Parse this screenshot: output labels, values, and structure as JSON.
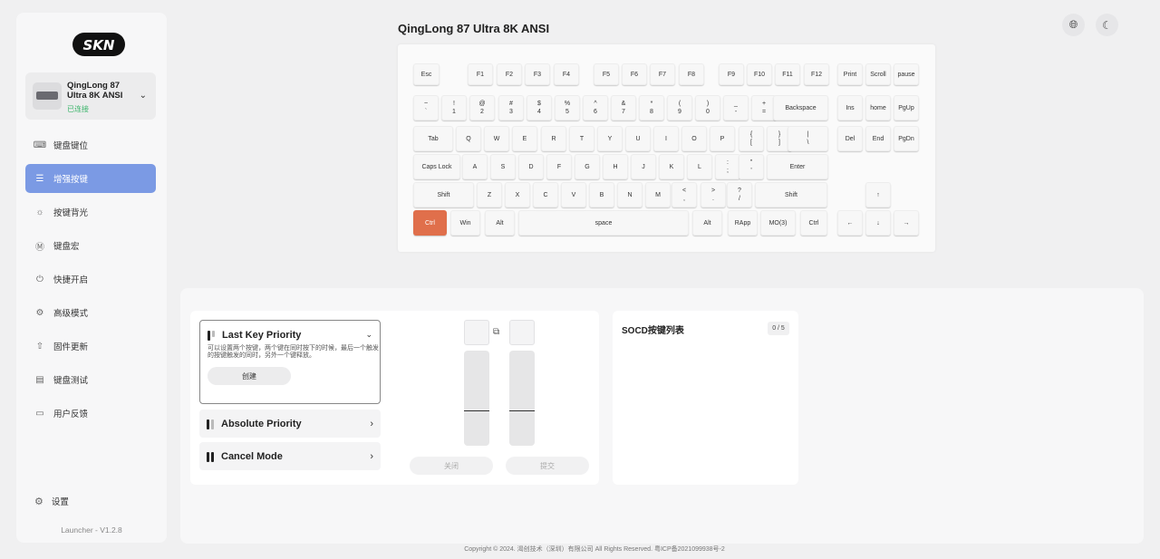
{
  "sidebar": {
    "logo": "SKN",
    "device": {
      "name": "QingLong 87 Ultra 8K ANSI",
      "status": "已连接"
    },
    "items": [
      {
        "label": "键盘键位",
        "icon": "keyboard-icon"
      },
      {
        "label": "增强按键",
        "icon": "list-icon",
        "active": true
      },
      {
        "label": "按键背光",
        "icon": "sun-icon"
      },
      {
        "label": "键盘宏",
        "icon": "macro-icon"
      },
      {
        "label": "快捷开启",
        "icon": "power-icon"
      },
      {
        "label": "高级模式",
        "icon": "gear-icon"
      },
      {
        "label": "固件更新",
        "icon": "upload-icon"
      },
      {
        "label": "键盘测试",
        "icon": "test-icon"
      },
      {
        "label": "用户反馈",
        "icon": "feedback-icon"
      }
    ],
    "settings_label": "设置",
    "version": "Launcher - V1.2.8"
  },
  "header": {
    "title": "QingLong 87 Ultra 8K ANSI"
  },
  "keyboard": {
    "accent": "#e06f4b",
    "row_f": [
      "Esc",
      "F1",
      "F2",
      "F3",
      "F4",
      "F5",
      "F6",
      "F7",
      "F8",
      "F9",
      "F10",
      "F11",
      "F12",
      "Print",
      "Scroll",
      "pause"
    ],
    "row_num": [
      "~\n`",
      "!\n1",
      "@\n2",
      "#\n3",
      "$\n4",
      "%\n5",
      "^\n6",
      "&\n7",
      "*\n8",
      "(\n9",
      ")\n0",
      "_\n-",
      "+\n=",
      "Backspace",
      "Ins",
      "home",
      "PgUp"
    ],
    "row_tab": [
      "Tab",
      "Q",
      "W",
      "E",
      "R",
      "T",
      "Y",
      "U",
      "I",
      "O",
      "P",
      "{\n[",
      "}\n]",
      "|\n\\",
      "Del",
      "End",
      "PgDn"
    ],
    "row_caps": [
      "Caps Lock",
      "A",
      "S",
      "D",
      "F",
      "G",
      "H",
      "J",
      "K",
      "L",
      ":\n;",
      "\"\n'",
      "Enter"
    ],
    "row_shift": [
      "Shift",
      "Z",
      "X",
      "C",
      "V",
      "B",
      "N",
      "M",
      "<\n,",
      ">\n.",
      "?\n/",
      "Shift",
      "↑"
    ],
    "row_ctrl": [
      "Ctrl",
      "Win",
      "Alt",
      "space",
      "Alt",
      "RApp",
      "MO(3)",
      "Ctrl",
      "←",
      "↓",
      "→"
    ]
  },
  "modes": {
    "last": {
      "title": "Last Key Priority",
      "desc": "可以设置两个按键，两个键在同时按下的时候，最后一个触发的按键触发的同时，另外一个键释放。",
      "create": "创建"
    },
    "absolute": {
      "title": "Absolute Priority"
    },
    "cancel": {
      "title": "Cancel Mode"
    }
  },
  "controls": {
    "close": "关闭",
    "submit": "提交"
  },
  "socd": {
    "title": "SOCD按键列表",
    "count": "0 / 5"
  },
  "footer": "Copyright © 2024. 渴创技术（深圳）有限公司 All Rights Reserved. 粤ICP备2021099938号-2"
}
